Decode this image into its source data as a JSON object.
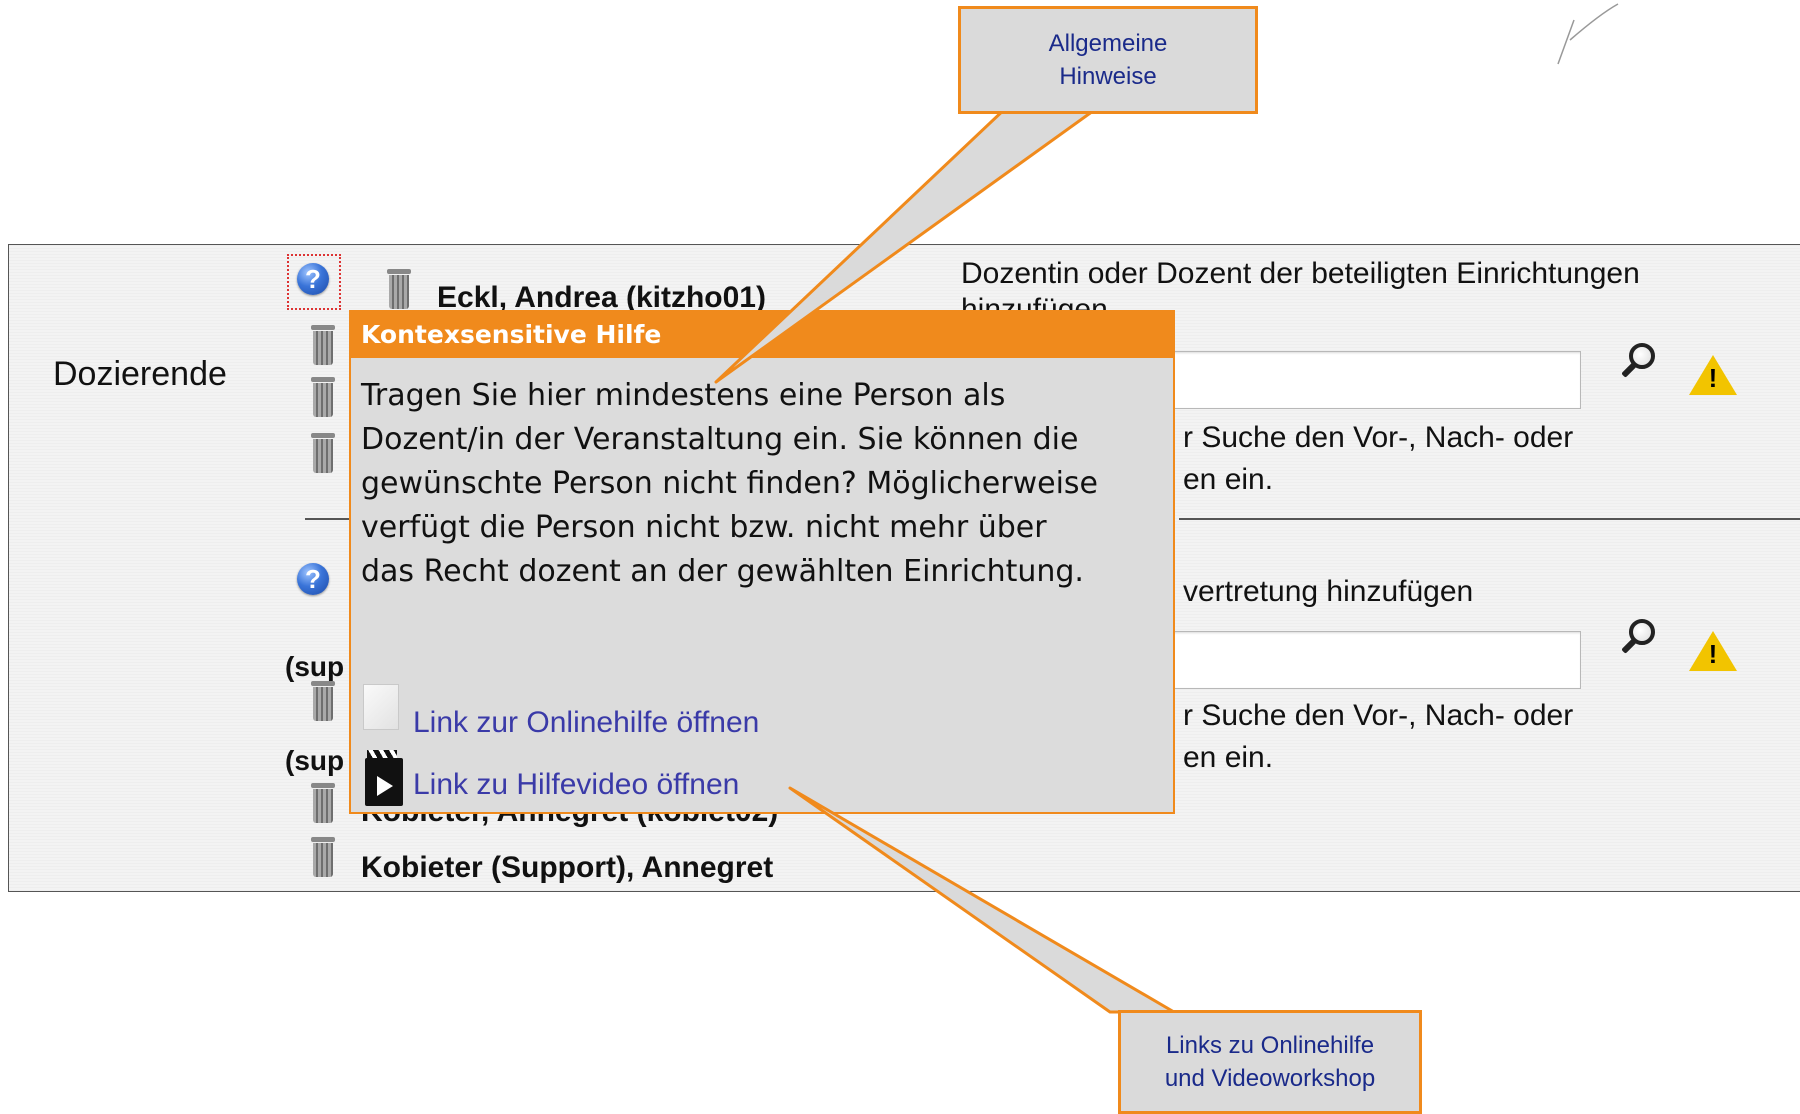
{
  "form": {
    "section_label": "Dozierende",
    "add_teacher_heading": "Dozentin oder Dozent der beteiligten Einrichtungen",
    "add_teacher_heading_cont": "hinzufügen",
    "search_hint_1": "r Suche den Vor-, Nach- oder",
    "search_hint_1_cont": "en ein.",
    "add_substitute_heading": "vertretung hinzufügen",
    "search_hint_2": "r Suche den Vor-, Nach- oder",
    "search_hint_2_cont": "en ein.",
    "teachers": [
      "Eckl, Andrea (kitzho01)",
      "Kobieter, Annegret (kobiet02)",
      "Kobieter (Support), Annegret"
    ],
    "partial_labels": [
      "(sup",
      "(sup"
    ]
  },
  "popup": {
    "title": "Kontexsensitive Hilfe",
    "body_lines": [
      "Tragen Sie hier mindestens eine Person als",
      "Dozent/in der Veranstaltung ein. Sie können die",
      "gewünschte Person nicht finden? Möglicherweise",
      "verfügt die Person nicht bzw. nicht mehr über",
      "das Recht dozent an der gewählten Einrichtung."
    ],
    "link_online_help": "Link zur Onlinehilfe öffnen",
    "link_help_video": "Link zu Hilfevideo öffnen"
  },
  "callouts": {
    "top_line1": "Allgemeine",
    "top_line2": "Hinweise",
    "bottom_line1": "Links zu Onlinehilfe",
    "bottom_line2": "und Videoworkshop"
  },
  "icons": [
    "help-icon",
    "trash-icon",
    "magnifier-icon",
    "warning-icon",
    "document-icon",
    "film-icon"
  ],
  "colors": {
    "accent": "#f08a1c",
    "link": "#3a3aa8",
    "callout_text": "#1a2a8a",
    "help_blue": "#3a74d8",
    "warning": "#f2c400"
  }
}
